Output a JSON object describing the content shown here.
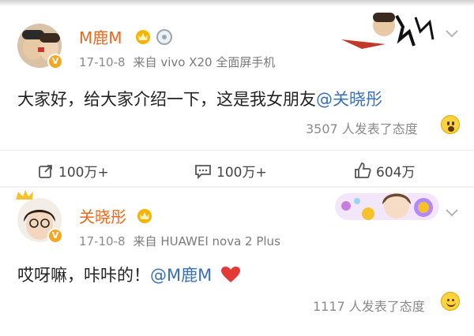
{
  "post1": {
    "username": "M鹿M",
    "date": "17-10-8",
    "source": "来自 vivo X20 全面屏手机",
    "text_main": "大家好，给大家介绍一下，这是我女朋友",
    "mention": "@关晓彤",
    "reaction_count": "3507 人发表了态度"
  },
  "actions": {
    "repost": "100万+",
    "comment": "100万+",
    "like": "604万"
  },
  "post2": {
    "username": "关晓彤",
    "date": "17-10-8",
    "source": "来自 HUAWEI nova 2 Plus",
    "text_main": "哎呀嘛，咔咔的！",
    "mention": "@M鹿M",
    "reaction_count": "1117 人发表了态度"
  },
  "colors": {
    "username": "#e86a1f",
    "mention": "#3b6fb6",
    "heart": "#e53935"
  },
  "icons": [
    "crown-badge-icon",
    "level-badge-icon",
    "chevron-down-icon",
    "repost-icon",
    "comment-icon",
    "like-icon",
    "emoji-surprised-icon",
    "emoji-laugh-icon",
    "heart-icon",
    "verified-badge-icon"
  ]
}
